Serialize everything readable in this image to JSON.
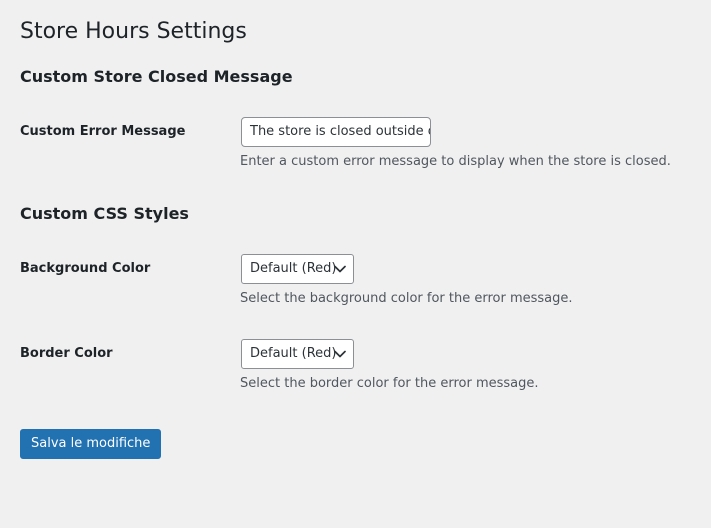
{
  "page": {
    "title": "Store Hours Settings"
  },
  "sections": [
    {
      "title": "Custom Store Closed Message",
      "fields": [
        {
          "label": "Custom Error Message",
          "value": "The store is closed outside o",
          "description": "Enter a custom error message to display when the store is closed."
        }
      ]
    },
    {
      "title": "Custom CSS Styles",
      "fields": [
        {
          "label": "Background Color",
          "selected": "Default (Red)",
          "description": "Select the background color for the error message."
        },
        {
          "label": "Border Color",
          "selected": "Default (Red)",
          "description": "Select the border color for the error message."
        }
      ]
    }
  ],
  "actions": {
    "save_label": "Salva le modifiche"
  },
  "colors": {
    "background": "#f0f0f1",
    "text": "#1d2327",
    "description": "#50575e",
    "input_border": "#8c8f94",
    "primary": "#2271b1",
    "primary_text": "#ffffff"
  },
  "icons": {
    "dropdown": "chevron-down-icon"
  }
}
